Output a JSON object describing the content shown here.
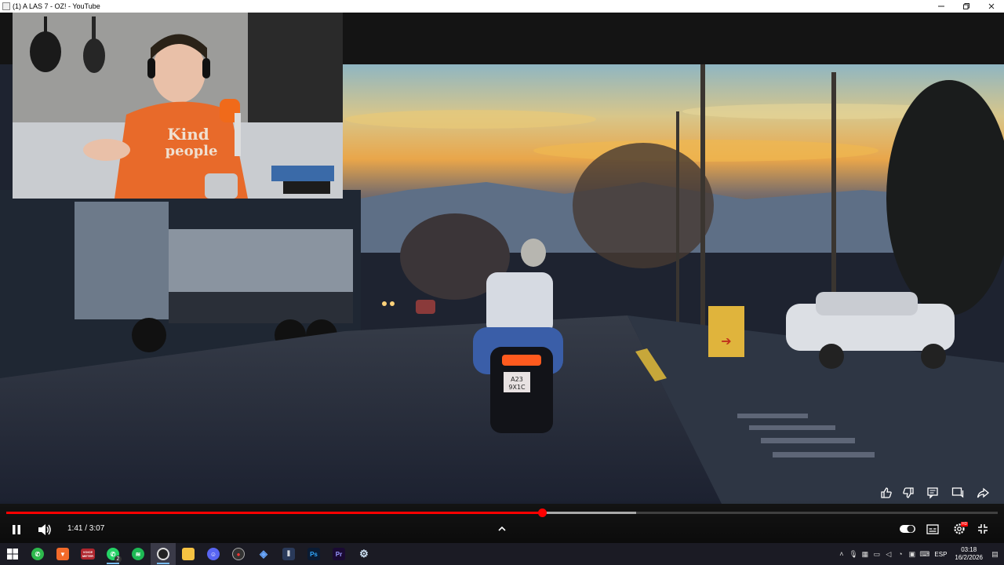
{
  "window": {
    "title": "(1) A LAS 7 - OZ! - YouTube",
    "minimize_icon": "minimize-icon",
    "maximize_icon": "restore-icon",
    "close_icon": "close-icon"
  },
  "video": {
    "plate_text_line1": "A23",
    "plate_text_line2": "9X1C",
    "webcam_shirt_text_line1": "Kind",
    "webcam_shirt_text_line2": "people"
  },
  "player": {
    "current_time": "1:41",
    "duration": "3:07",
    "time_display": "1:41 / 3:07",
    "played_fraction": 0.54,
    "buffered_fraction": 0.635,
    "top_actions": [
      "like-icon",
      "dislike-icon",
      "comments-icon",
      "chat-icon",
      "share-icon"
    ],
    "controls": [
      "pause-icon",
      "volume-icon",
      "chevron-up-icon",
      "autoplay-toggle",
      "subtitles-icon",
      "settings-icon",
      "exit-fullscreen-icon"
    ],
    "settings_badge": "HD"
  },
  "taskbar": {
    "apps": [
      {
        "name": "start-icon",
        "label": ""
      },
      {
        "name": "whatsapp-web-icon",
        "label": ""
      },
      {
        "name": "brave-icon",
        "label": ""
      },
      {
        "name": "voicemeeter-icon",
        "label": "VOICE METER"
      },
      {
        "name": "whatsapp-icon",
        "label": "2"
      },
      {
        "name": "spotify-icon",
        "label": ""
      },
      {
        "name": "obs-icon",
        "label": ""
      },
      {
        "name": "file-explorer-icon",
        "label": ""
      },
      {
        "name": "discord-icon",
        "label": ""
      },
      {
        "name": "obs-recording-icon",
        "label": ""
      },
      {
        "name": "streamer-icon",
        "label": ""
      },
      {
        "name": "audio-editor-icon",
        "label": ""
      },
      {
        "name": "photoshop-icon",
        "label": "Ps"
      },
      {
        "name": "premiere-icon",
        "label": "Pr"
      },
      {
        "name": "steam-icon",
        "label": ""
      }
    ],
    "language": "ESP",
    "time": "03:18",
    "date": "16/2/2026"
  },
  "colors": {
    "progress_played": "#ff0000",
    "taskbar_bg": "#1b1b24",
    "accent": "#76b9ed"
  }
}
